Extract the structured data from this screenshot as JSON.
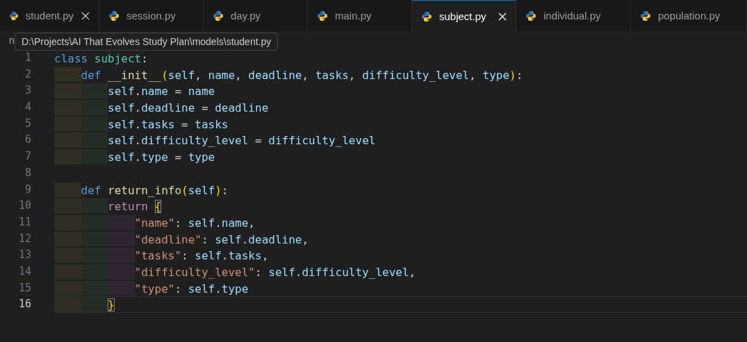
{
  "tabs": [
    {
      "label": "student.py",
      "selected": false,
      "close_button": true
    },
    {
      "label": "session.py",
      "selected": false,
      "close_button": false
    },
    {
      "label": "day.py",
      "selected": false,
      "close_button": false
    },
    {
      "label": "main.py",
      "selected": false,
      "close_button": false
    },
    {
      "label": "subject.py",
      "selected": true,
      "close_button": true
    },
    {
      "label": "individual.py",
      "selected": false,
      "close_button": false
    },
    {
      "label": "population.py",
      "selected": false,
      "close_button": false
    }
  ],
  "breadcrumb": {
    "text": "n"
  },
  "tooltip": {
    "text": "D:\\Projects\\AI That Evolves Study Plan\\models\\student.py"
  },
  "editor": {
    "lines": [
      {
        "number": "1",
        "current": false,
        "tokens": [
          {
            "t": "class ",
            "kind": "keyword"
          },
          {
            "t": "subject",
            "kind": "class"
          },
          {
            "t": ":",
            "kind": "punct"
          }
        ],
        "children": [
          {
            "number": "2",
            "current": false,
            "tokens": [
              {
                "t": "def ",
                "kind": "keyword"
              },
              {
                "t": "__init__",
                "kind": "function"
              },
              {
                "t": "(",
                "kind": "bracket"
              },
              {
                "t": "self",
                "kind": "variable"
              },
              {
                "t": ", ",
                "kind": "punct"
              },
              {
                "t": "name",
                "kind": "variable"
              },
              {
                "t": ", ",
                "kind": "punct"
              },
              {
                "t": "deadline",
                "kind": "variable"
              },
              {
                "t": ", ",
                "kind": "punct"
              },
              {
                "t": "tasks",
                "kind": "variable"
              },
              {
                "t": ", ",
                "kind": "punct"
              },
              {
                "t": "difficulty_level",
                "kind": "variable"
              },
              {
                "t": ", ",
                "kind": "punct"
              },
              {
                "t": "type",
                "kind": "variable"
              },
              {
                "t": ")",
                "kind": "bracket"
              },
              {
                "t": ":",
                "kind": "punct"
              }
            ],
            "children": [
              {
                "number": "3",
                "current": false,
                "tokens": [
                  {
                    "t": "self",
                    "kind": "variable"
                  },
                  {
                    "t": ".",
                    "kind": "punct"
                  },
                  {
                    "t": "name",
                    "kind": "variable"
                  },
                  {
                    "t": " = ",
                    "kind": "punct"
                  },
                  {
                    "t": "name",
                    "kind": "variable"
                  }
                ]
              },
              {
                "number": "4",
                "current": false,
                "tokens": [
                  {
                    "t": "self",
                    "kind": "variable"
                  },
                  {
                    "t": ".",
                    "kind": "punct"
                  },
                  {
                    "t": "deadline",
                    "kind": "variable"
                  },
                  {
                    "t": " = ",
                    "kind": "punct"
                  },
                  {
                    "t": "deadline",
                    "kind": "variable"
                  }
                ]
              },
              {
                "number": "5",
                "current": false,
                "tokens": [
                  {
                    "t": "self",
                    "kind": "variable"
                  },
                  {
                    "t": ".",
                    "kind": "punct"
                  },
                  {
                    "t": "tasks",
                    "kind": "variable"
                  },
                  {
                    "t": " = ",
                    "kind": "punct"
                  },
                  {
                    "t": "tasks",
                    "kind": "variable"
                  }
                ]
              },
              {
                "number": "6",
                "current": false,
                "tokens": [
                  {
                    "t": "self",
                    "kind": "variable"
                  },
                  {
                    "t": ".",
                    "kind": "punct"
                  },
                  {
                    "t": "difficulty_level",
                    "kind": "variable"
                  },
                  {
                    "t": " = ",
                    "kind": "punct"
                  },
                  {
                    "t": "difficulty_level",
                    "kind": "variable"
                  }
                ]
              },
              {
                "number": "7",
                "current": false,
                "tokens": [
                  {
                    "t": "self",
                    "kind": "variable"
                  },
                  {
                    "t": ".",
                    "kind": "punct"
                  },
                  {
                    "t": "type",
                    "kind": "variable"
                  },
                  {
                    "t": " = ",
                    "kind": "punct"
                  },
                  {
                    "t": "type",
                    "kind": "variable"
                  }
                ]
              }
            ]
          },
          {
            "number": "8",
            "current": false
          },
          {
            "number": "9",
            "current": false,
            "tokens": [
              {
                "t": "def ",
                "kind": "keyword"
              },
              {
                "t": "return_info",
                "kind": "function"
              },
              {
                "t": "(",
                "kind": "bracket"
              },
              {
                "t": "self",
                "kind": "variable"
              },
              {
                "t": ")",
                "kind": "bracket"
              },
              {
                "t": ":",
                "kind": "punct"
              }
            ],
            "children": [
              {
                "number": "10",
                "current": false,
                "tokens": [
                  {
                    "t": "return ",
                    "kind": "control"
                  },
                  {
                    "t": "{",
                    "kind": "matched-bracket"
                  }
                ],
                "children": [
                  {
                    "number": "11",
                    "current": false,
                    "tokens": [
                      {
                        "t": "\"name\"",
                        "kind": "string"
                      },
                      {
                        "t": ": ",
                        "kind": "punct"
                      },
                      {
                        "t": "self",
                        "kind": "variable"
                      },
                      {
                        "t": ".",
                        "kind": "punct"
                      },
                      {
                        "t": "name",
                        "kind": "variable"
                      },
                      {
                        "t": ",",
                        "kind": "punct"
                      }
                    ]
                  },
                  {
                    "number": "12",
                    "current": false,
                    "tokens": [
                      {
                        "t": "\"deadline\"",
                        "kind": "string"
                      },
                      {
                        "t": ": ",
                        "kind": "punct"
                      },
                      {
                        "t": "self",
                        "kind": "variable"
                      },
                      {
                        "t": ".",
                        "kind": "punct"
                      },
                      {
                        "t": "deadline",
                        "kind": "variable"
                      },
                      {
                        "t": ",",
                        "kind": "punct"
                      }
                    ]
                  },
                  {
                    "number": "13",
                    "current": false,
                    "tokens": [
                      {
                        "t": "\"tasks\"",
                        "kind": "string"
                      },
                      {
                        "t": ": ",
                        "kind": "punct"
                      },
                      {
                        "t": "self",
                        "kind": "variable"
                      },
                      {
                        "t": ".",
                        "kind": "punct"
                      },
                      {
                        "t": "tasks",
                        "kind": "variable"
                      },
                      {
                        "t": ",",
                        "kind": "punct"
                      }
                    ]
                  },
                  {
                    "number": "14",
                    "current": false,
                    "tokens": [
                      {
                        "t": "\"difficulty_level\"",
                        "kind": "string"
                      },
                      {
                        "t": ": ",
                        "kind": "punct"
                      },
                      {
                        "t": "self",
                        "kind": "variable"
                      },
                      {
                        "t": ".",
                        "kind": "punct"
                      },
                      {
                        "t": "difficulty_level",
                        "kind": "variable"
                      },
                      {
                        "t": ",",
                        "kind": "punct"
                      }
                    ]
                  },
                  {
                    "number": "15",
                    "current": false,
                    "tokens": [
                      {
                        "t": "\"type\"",
                        "kind": "string"
                      },
                      {
                        "t": ": ",
                        "kind": "punct"
                      },
                      {
                        "t": "self",
                        "kind": "variable"
                      },
                      {
                        "t": ".",
                        "kind": "punct"
                      },
                      {
                        "t": "type",
                        "kind": "variable"
                      }
                    ]
                  }
                ]
              },
              {
                "number": "16",
                "current": true,
                "tokens": [
                  {
                    "t": "}",
                    "kind": "matched-bracket"
                  }
                ]
              }
            ]
          }
        ]
      }
    ]
  }
}
